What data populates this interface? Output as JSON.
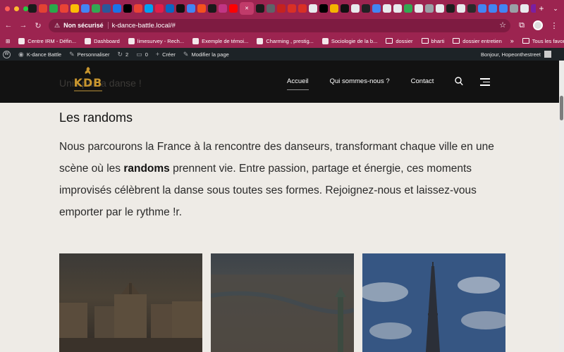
{
  "browser": {
    "traffic_colors": [
      "#ff5f57",
      "#febc2e",
      "#28c840"
    ],
    "active_tab_close": "✕",
    "new_tab": "+",
    "security_label": "Non sécurisé",
    "url": "k-dance-battle.local/#",
    "bookmarks": [
      {
        "label": "Centre IRM - Défin...",
        "icon": "page-icon"
      },
      {
        "label": "Dashboard",
        "icon": "dashboard-icon"
      },
      {
        "label": "limesurvey - Rech...",
        "icon": "google-icon"
      },
      {
        "label": "Exemple de témoi...",
        "icon": "pen-icon"
      },
      {
        "label": "Charming , prestig...",
        "icon": "airbnb-icon"
      },
      {
        "label": "Sociologie de la b...",
        "icon": "doc-icon"
      },
      {
        "label": "dossier",
        "icon": "folder-icon"
      },
      {
        "label": "bharti",
        "icon": "folder-icon"
      },
      {
        "label": "dossier entretien",
        "icon": "folder-icon"
      }
    ],
    "bookmarks_more": "»",
    "all_bookmarks": "Tous les favoris"
  },
  "wp_admin": {
    "site_name": "K-dance Battle",
    "customize": "Personnaliser",
    "updates_count": "2",
    "comments_count": "0",
    "new": "Créer",
    "edit_page": "Modifier la page",
    "greeting": "Bonjour, Hopeonthestreet"
  },
  "site": {
    "logo_text": "KDB",
    "behind_text": "Unis par la danse !",
    "nav": [
      "Accueil",
      "Qui sommes-nous ?",
      "Contact"
    ],
    "active_nav": "Accueil"
  },
  "content": {
    "heading": "Les randoms",
    "para_before": "Nous parcourons la France à la rencontre des danseurs, transformant chaque ville en une scène où les ",
    "para_bold": "randoms",
    "para_after": " prennent vie. Entre passion, partage et énergie, ces moments improvisés célèbrent la danse sous toutes ses formes. Rejoignez-nous et laissez-vous emporter par le rythme !r."
  }
}
